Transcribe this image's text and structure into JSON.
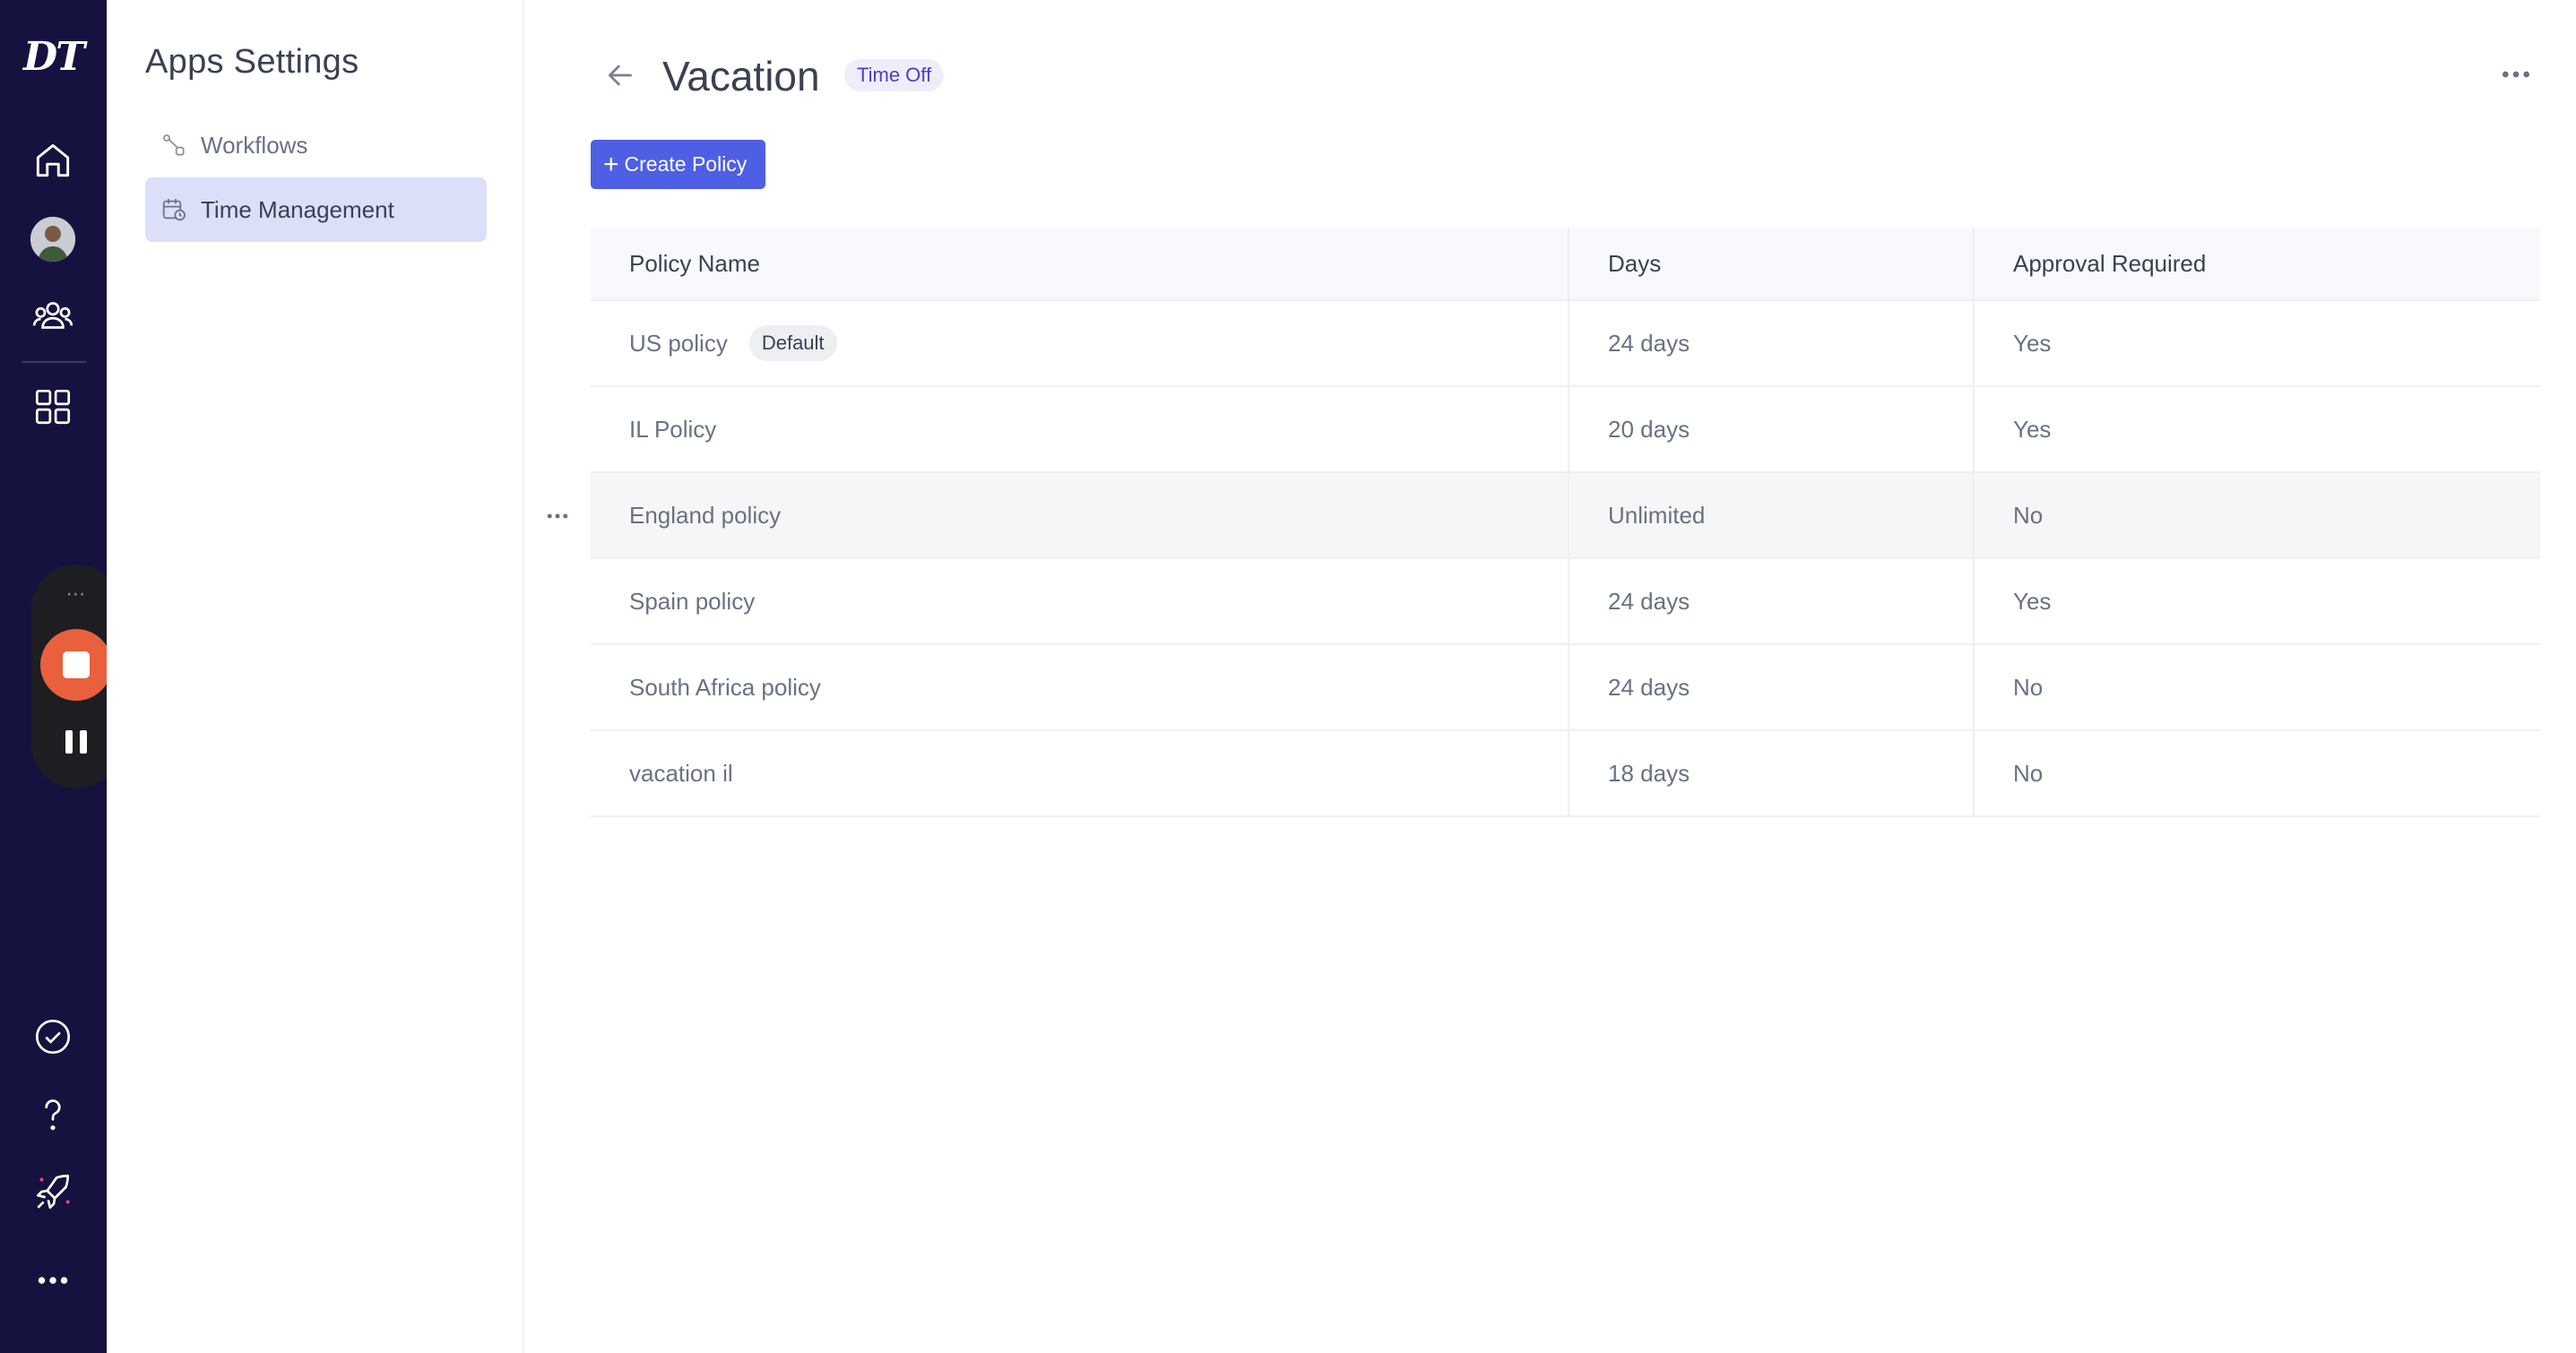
{
  "app": {
    "logo": "DT"
  },
  "settings": {
    "title": "Apps Settings",
    "items": [
      {
        "label": "Workflows",
        "icon": "workflow-icon",
        "active": false
      },
      {
        "label": "Time Management",
        "icon": "calendar-clock-icon",
        "active": true
      }
    ]
  },
  "page": {
    "title": "Vacation",
    "badge": "Time Off",
    "create_button": "Create Policy"
  },
  "table": {
    "columns": [
      "Policy Name",
      "Days",
      "Approval Required"
    ],
    "default_label": "Default",
    "rows": [
      {
        "name": "US policy",
        "days": "24 days",
        "approval": "Yes",
        "default": true
      },
      {
        "name": "IL Policy",
        "days": "20 days",
        "approval": "Yes",
        "default": false
      },
      {
        "name": "England policy",
        "days": "Unlimited",
        "approval": "No",
        "default": false
      },
      {
        "name": "Spain policy",
        "days": "24 days",
        "approval": "Yes",
        "default": false
      },
      {
        "name": "South Africa policy",
        "days": "24 days",
        "approval": "No",
        "default": false
      },
      {
        "name": "vacation il",
        "days": "18 days",
        "approval": "No",
        "default": false
      }
    ]
  },
  "colors": {
    "rail": "#16123f",
    "accent": "#4f5fe4",
    "active_nav": "#dcdff8",
    "recorder_stop": "#e8603c"
  }
}
